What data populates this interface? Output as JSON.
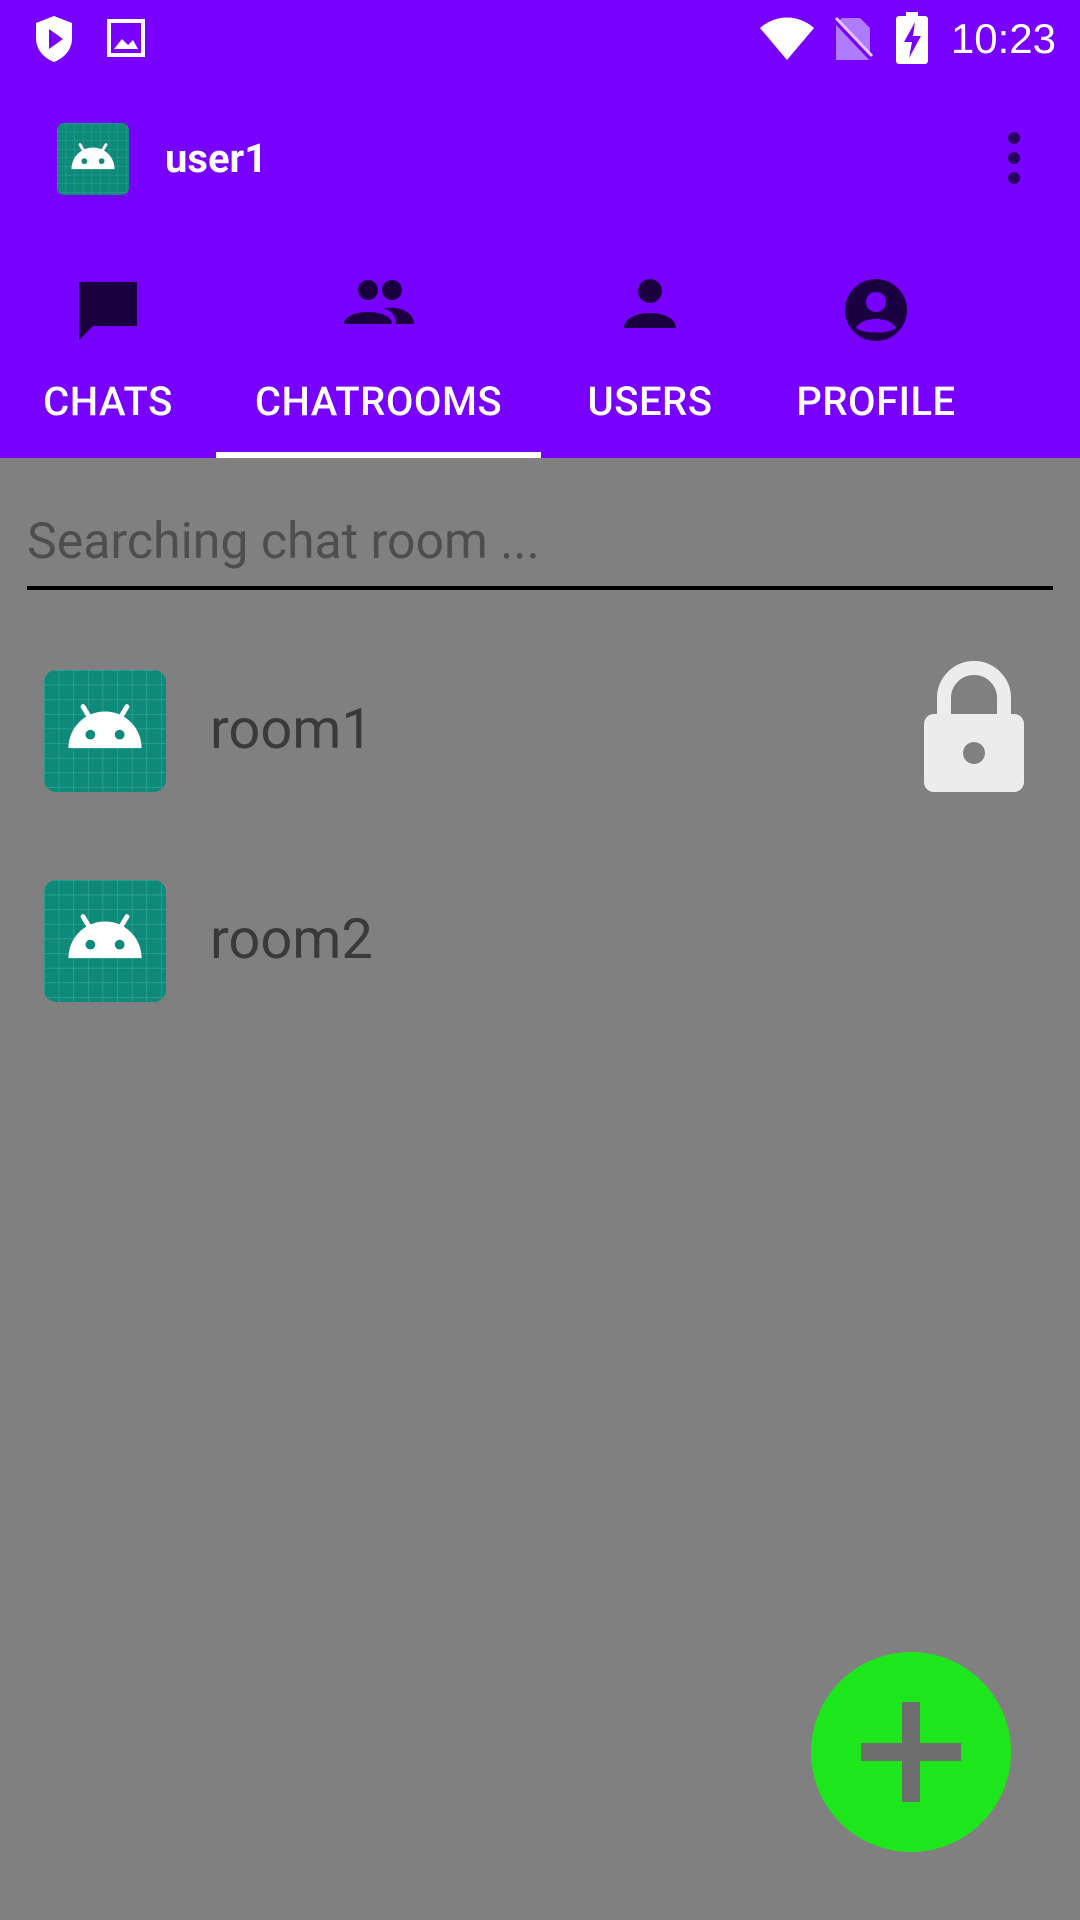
{
  "status_bar": {
    "time": "10:23",
    "icons": [
      "shield-play-icon",
      "image-icon",
      "wifi-icon",
      "no-sim-icon",
      "battery-charging-icon"
    ]
  },
  "toolbar": {
    "title": "user1",
    "avatar_icon": "android-icon",
    "overflow_icon": "more-vert-icon"
  },
  "tabs": [
    {
      "label": "CHATS",
      "icon": "chat-icon",
      "selected": false
    },
    {
      "label": "CHATROOMS",
      "icon": "group-icon",
      "selected": true
    },
    {
      "label": "USERS",
      "icon": "person-icon",
      "selected": false
    },
    {
      "label": "PROFILE",
      "icon": "account-circle-icon",
      "selected": false
    }
  ],
  "search": {
    "placeholder": "Searching chat room ..."
  },
  "rooms": [
    {
      "name": "room1",
      "locked": true
    },
    {
      "name": "room2",
      "locked": false
    }
  ],
  "fab": {
    "icon": "add-icon"
  },
  "colors": {
    "primary": "#7800ff",
    "background": "#808080",
    "fab": "#1ee61c",
    "avatar_teal": "#0d8a7a"
  }
}
